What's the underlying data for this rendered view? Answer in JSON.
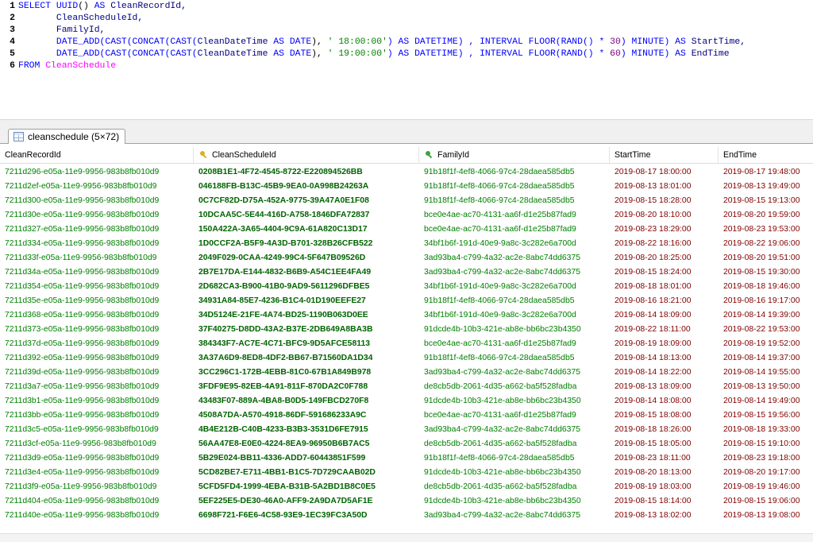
{
  "editor": {
    "lines": [
      {
        "n": "1"
      },
      {
        "n": "2"
      },
      {
        "n": "3"
      },
      {
        "n": "4"
      },
      {
        "n": "5"
      },
      {
        "n": "6"
      }
    ]
  },
  "sql": {
    "l1_select": "SELECT",
    "l1_func": "UUID",
    "l1_paren": "()",
    "l1_as": "AS",
    "l1_alias": "CleanRecordId,",
    "l2": "CleanScheduleId,",
    "l3": "FamilyId,",
    "l4_a": "DATE_ADD(CAST(CONCAT(CAST(",
    "l4_col": "CleanDateTime",
    "l4_b": " AS ",
    "l4_date": "DATE",
    "l4_c": "), ",
    "l4_str": "' 18:00:00'",
    "l4_d": ") AS ",
    "l4_dt": "DATETIME",
    "l4_e": ") , INTERVAL FLOOR(RAND() * ",
    "l4_num": "30",
    "l4_f": ") MINUTE) AS ",
    "l4_alias": "StartTime,",
    "l5_a": "DATE_ADD(CAST(CONCAT(CAST(",
    "l5_col": "CleanDateTime",
    "l5_b": " AS ",
    "l5_date": "DATE",
    "l5_c": "), ",
    "l5_str": "' 19:00:00'",
    "l5_d": ") AS ",
    "l5_dt": "DATETIME",
    "l5_e": ") , INTERVAL FLOOR(RAND() * ",
    "l5_num": "60",
    "l5_f": ") MINUTE) AS ",
    "l5_alias": "EndTime",
    "l6_from": "FROM",
    "l6_table": "CleanSchedule"
  },
  "result_tab": {
    "label": "cleanschedule (5×72)"
  },
  "columns": {
    "c1": "CleanRecordId",
    "c2": "CleanScheduleId",
    "c3": "FamilyId",
    "c4": "StartTime",
    "c5": "EndTime"
  },
  "rows": [
    [
      "7211d296-e05a-11e9-9956-983b8fb010d9",
      "0208B1E1-4F72-4545-8722-E220894526BB",
      "91b18f1f-4ef8-4066-97c4-28daea585db5",
      "2019-08-17 18:00:00",
      "2019-08-17 19:48:00"
    ],
    [
      "7211d2ef-e05a-11e9-9956-983b8fb010d9",
      "046188FB-B13C-45B9-9EA0-0A998B24263A",
      "91b18f1f-4ef8-4066-97c4-28daea585db5",
      "2019-08-13 18:01:00",
      "2019-08-13 19:49:00"
    ],
    [
      "7211d300-e05a-11e9-9956-983b8fb010d9",
      "0C7CF82D-D75A-452A-9775-39A47A0E1F08",
      "91b18f1f-4ef8-4066-97c4-28daea585db5",
      "2019-08-15 18:28:00",
      "2019-08-15 19:13:00"
    ],
    [
      "7211d30e-e05a-11e9-9956-983b8fb010d9",
      "10DCAA5C-5E44-416D-A758-1846DFA72837",
      "bce0e4ae-ac70-4131-aa6f-d1e25b87fad9",
      "2019-08-20 18:10:00",
      "2019-08-20 19:59:00"
    ],
    [
      "7211d327-e05a-11e9-9956-983b8fb010d9",
      "150A422A-3A65-4404-9C9A-61A820C13D17",
      "bce0e4ae-ac70-4131-aa6f-d1e25b87fad9",
      "2019-08-23 18:29:00",
      "2019-08-23 19:53:00"
    ],
    [
      "7211d334-e05a-11e9-9956-983b8fb010d9",
      "1D0CCF2A-B5F9-4A3D-B701-328B26CFB522",
      "34bf1b6f-191d-40e9-9a8c-3c282e6a700d",
      "2019-08-22 18:16:00",
      "2019-08-22 19:06:00"
    ],
    [
      "7211d33f-e05a-11e9-9956-983b8fb010d9",
      "2049F029-0CAA-4249-99C4-5F647B09526D",
      "3ad93ba4-c799-4a32-ac2e-8abc74dd6375",
      "2019-08-20 18:25:00",
      "2019-08-20 19:51:00"
    ],
    [
      "7211d34a-e05a-11e9-9956-983b8fb010d9",
      "2B7E17DA-E144-4832-B6B9-A54C1EE4FA49",
      "3ad93ba4-c799-4a32-ac2e-8abc74dd6375",
      "2019-08-15 18:24:00",
      "2019-08-15 19:30:00"
    ],
    [
      "7211d354-e05a-11e9-9956-983b8fb010d9",
      "2D682CA3-B900-41B0-9AD9-5611296DFBE5",
      "34bf1b6f-191d-40e9-9a8c-3c282e6a700d",
      "2019-08-18 18:01:00",
      "2019-08-18 19:46:00"
    ],
    [
      "7211d35e-e05a-11e9-9956-983b8fb010d9",
      "34931A84-85E7-4236-B1C4-01D190EEFE27",
      "91b18f1f-4ef8-4066-97c4-28daea585db5",
      "2019-08-16 18:21:00",
      "2019-08-16 19:17:00"
    ],
    [
      "7211d368-e05a-11e9-9956-983b8fb010d9",
      "34D5124E-21FE-4A74-BD25-1190B063D0EE",
      "34bf1b6f-191d-40e9-9a8c-3c282e6a700d",
      "2019-08-14 18:09:00",
      "2019-08-14 19:39:00"
    ],
    [
      "7211d373-e05a-11e9-9956-983b8fb010d9",
      "37F40275-D8DD-43A2-B37E-2DB649A8BA3B",
      "91dcde4b-10b3-421e-ab8e-bb6bc23b4350",
      "2019-08-22 18:11:00",
      "2019-08-22 19:53:00"
    ],
    [
      "7211d37d-e05a-11e9-9956-983b8fb010d9",
      "384343F7-AC7E-4C71-BFC9-9D5AFCE58113",
      "bce0e4ae-ac70-4131-aa6f-d1e25b87fad9",
      "2019-08-19 18:09:00",
      "2019-08-19 19:52:00"
    ],
    [
      "7211d392-e05a-11e9-9956-983b8fb010d9",
      "3A37A6D9-8ED8-4DF2-BB67-B71560DA1D34",
      "91b18f1f-4ef8-4066-97c4-28daea585db5",
      "2019-08-14 18:13:00",
      "2019-08-14 19:37:00"
    ],
    [
      "7211d39d-e05a-11e9-9956-983b8fb010d9",
      "3CC296C1-172B-4EBB-81C0-67B1A849B978",
      "3ad93ba4-c799-4a32-ac2e-8abc74dd6375",
      "2019-08-14 18:22:00",
      "2019-08-14 19:55:00"
    ],
    [
      "7211d3a7-e05a-11e9-9956-983b8fb010d9",
      "3FDF9E95-82EB-4A91-811F-870DA2C0F788",
      "de8cb5db-2061-4d35-a662-ba5f528fadba",
      "2019-08-13 18:09:00",
      "2019-08-13 19:50:00"
    ],
    [
      "7211d3b1-e05a-11e9-9956-983b8fb010d9",
      "43483F07-889A-4BA8-B0D5-149FBCD270F8",
      "91dcde4b-10b3-421e-ab8e-bb6bc23b4350",
      "2019-08-14 18:08:00",
      "2019-08-14 19:49:00"
    ],
    [
      "7211d3bb-e05a-11e9-9956-983b8fb010d9",
      "4508A7DA-A570-4918-86DF-591686233A9C",
      "bce0e4ae-ac70-4131-aa6f-d1e25b87fad9",
      "2019-08-15 18:08:00",
      "2019-08-15 19:56:00"
    ],
    [
      "7211d3c5-e05a-11e9-9956-983b8fb010d9",
      "4B4E212B-C40B-4233-B3B3-3531D6FE7915",
      "3ad93ba4-c799-4a32-ac2e-8abc74dd6375",
      "2019-08-18 18:26:00",
      "2019-08-18 19:33:00"
    ],
    [
      "7211d3cf-e05a-11e9-9956-983b8fb010d9",
      "56AA47E8-E0E0-4224-8EA9-96950B6B7AC5",
      "de8cb5db-2061-4d35-a662-ba5f528fadba",
      "2019-08-15 18:05:00",
      "2019-08-15 19:10:00"
    ],
    [
      "7211d3d9-e05a-11e9-9956-983b8fb010d9",
      "5B29E024-BB11-4336-ADD7-60443851F599",
      "91b18f1f-4ef8-4066-97c4-28daea585db5",
      "2019-08-23 18:11:00",
      "2019-08-23 19:18:00"
    ],
    [
      "7211d3e4-e05a-11e9-9956-983b8fb010d9",
      "5CD82BE7-E711-4BB1-B1C5-7D729CAAB02D",
      "91dcde4b-10b3-421e-ab8e-bb6bc23b4350",
      "2019-08-20 18:13:00",
      "2019-08-20 19:17:00"
    ],
    [
      "7211d3f9-e05a-11e9-9956-983b8fb010d9",
      "5CFD5FD4-1999-4EBA-B31B-5A2BD1B8C0E5",
      "de8cb5db-2061-4d35-a662-ba5f528fadba",
      "2019-08-19 18:03:00",
      "2019-08-19 19:46:00"
    ],
    [
      "7211d404-e05a-11e9-9956-983b8fb010d9",
      "5EF225E5-DE30-46A0-AFF9-2A9DA7D5AF1E",
      "91dcde4b-10b3-421e-ab8e-bb6bc23b4350",
      "2019-08-15 18:14:00",
      "2019-08-15 19:06:00"
    ],
    [
      "7211d40e-e05a-11e9-9956-983b8fb010d9",
      "6698F721-F6E6-4C58-93E9-1EC39FC3A50D",
      "3ad93ba4-c799-4a32-ac2e-8abc74dd6375",
      "2019-08-13 18:02:00",
      "2019-08-13 19:08:00"
    ]
  ]
}
